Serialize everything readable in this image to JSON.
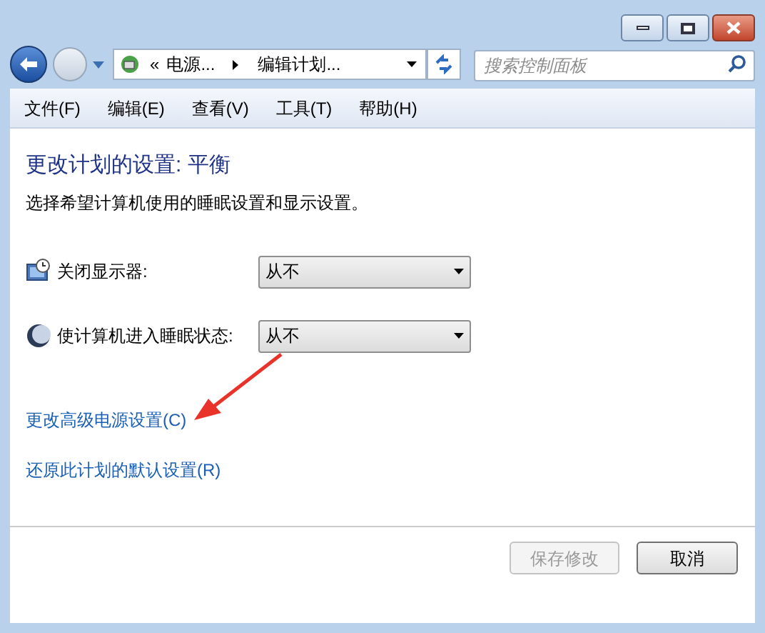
{
  "address_bar": {
    "crumbs": [
      "«",
      "电源...",
      "编辑计划..."
    ]
  },
  "search": {
    "placeholder": "搜索控制面板"
  },
  "menu": [
    "文件(F)",
    "编辑(E)",
    "查看(V)",
    "工具(T)",
    "帮助(H)"
  ],
  "heading": "更改计划的设置: 平衡",
  "description": "选择希望计算机使用的睡眠设置和显示设置。",
  "settings": [
    {
      "kind": "display",
      "label": "关闭显示器:",
      "value": "从不"
    },
    {
      "kind": "sleep",
      "label": "使计算机进入睡眠状态:",
      "value": "从不"
    }
  ],
  "links": [
    "更改高级电源设置(C)",
    "还原此计划的默认设置(R)"
  ],
  "buttons": [
    {
      "label": "保存修改",
      "disabled": true
    },
    {
      "label": "取消",
      "disabled": false
    }
  ]
}
